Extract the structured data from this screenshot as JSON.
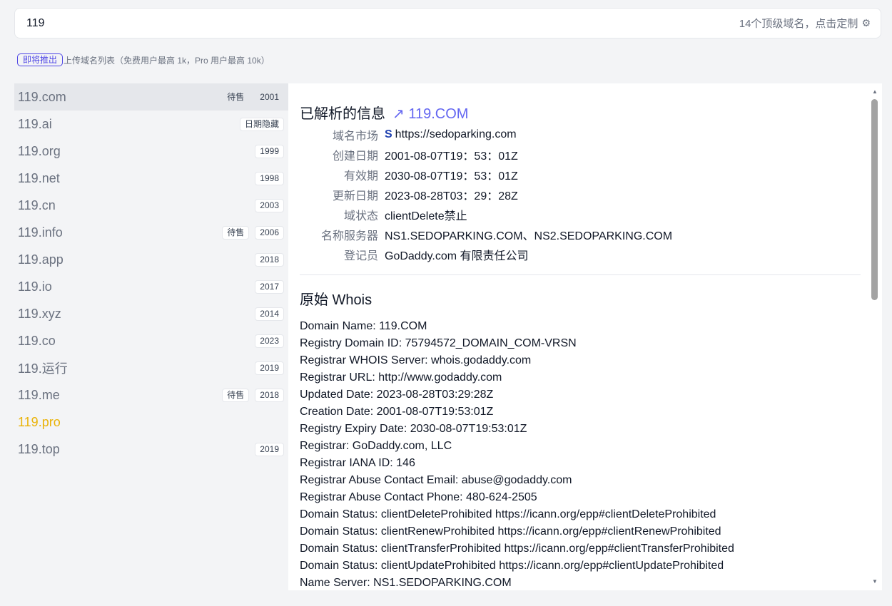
{
  "search": {
    "value": "119",
    "tld_config_label": "14个顶级域名，点击定制",
    "gear_icon": "gear-icon"
  },
  "notice": {
    "badge": "即将推出",
    "text": "上传域名列表（免费用户最高 1k，Pro 用户最高 10k）"
  },
  "domains": [
    {
      "name": "119.com",
      "tags": [
        "待售",
        "2001"
      ],
      "active": true
    },
    {
      "name": "119.ai",
      "tags": [
        "日期隐藏"
      ]
    },
    {
      "name": "119.org",
      "tags": [
        "1999"
      ]
    },
    {
      "name": "119.net",
      "tags": [
        "1998"
      ]
    },
    {
      "name": "119.cn",
      "tags": [
        "2003"
      ]
    },
    {
      "name": "119.info",
      "tags": [
        "待售",
        "2006"
      ]
    },
    {
      "name": "119.app",
      "tags": [
        "2018"
      ]
    },
    {
      "name": "119.io",
      "tags": [
        "2017"
      ]
    },
    {
      "name": "119.xyz",
      "tags": [
        "2014"
      ]
    },
    {
      "name": "119.co",
      "tags": [
        "2023"
      ]
    },
    {
      "name": "119.运行",
      "tags": [
        "2019"
      ]
    },
    {
      "name": "119.me",
      "tags": [
        "待售",
        "2018"
      ]
    },
    {
      "name": "119.pro",
      "tags": [],
      "available": true
    },
    {
      "name": "119.top",
      "tags": [
        "2019"
      ]
    }
  ],
  "detail": {
    "parsed_title": "已解析的信息",
    "link_label": "↗ 119.COM",
    "fields": [
      {
        "label": "域名市场",
        "value": "https://sedoparking.com",
        "icon": "S"
      },
      {
        "label": "创建日期",
        "value": "2001-08-07T19：53：01Z"
      },
      {
        "label": "有效期",
        "value": "2030-08-07T19：53：01Z"
      },
      {
        "label": "更新日期",
        "value": "2023-08-28T03：29：28Z"
      },
      {
        "label": "域状态",
        "value": "clientDelete禁止"
      },
      {
        "label": "名称服务器",
        "value": "NS1.SEDOPARKING.COM、NS2.SEDOPARKING.COM"
      },
      {
        "label": "登记员",
        "value": "GoDaddy.com 有限责任公司"
      }
    ],
    "raw_title": "原始 Whois",
    "raw_lines": [
      "Domain Name: 119.COM",
      "Registry Domain ID: 75794572_DOMAIN_COM-VRSN",
      "Registrar WHOIS Server: whois.godaddy.com",
      "Registrar URL: http://www.godaddy.com",
      "Updated Date: 2023-08-28T03:29:28Z",
      "Creation Date: 2001-08-07T19:53:01Z",
      "Registry Expiry Date: 2030-08-07T19:53:01Z",
      "Registrar: GoDaddy.com, LLC",
      "Registrar IANA ID: 146",
      "Registrar Abuse Contact Email: abuse@godaddy.com",
      "Registrar Abuse Contact Phone: 480-624-2505",
      "Domain Status: clientDeleteProhibited https://icann.org/epp#clientDeleteProhibited",
      "Domain Status: clientRenewProhibited https://icann.org/epp#clientRenewProhibited",
      "Domain Status: clientTransferProhibited https://icann.org/epp#clientTransferProhibited",
      "Domain Status: clientUpdateProhibited https://icann.org/epp#clientUpdateProhibited",
      "Name Server: NS1.SEDOPARKING.COM"
    ]
  },
  "colors": {
    "accent": "#6366f1",
    "available": "#eab308",
    "badge_border": "#4f46e5"
  }
}
